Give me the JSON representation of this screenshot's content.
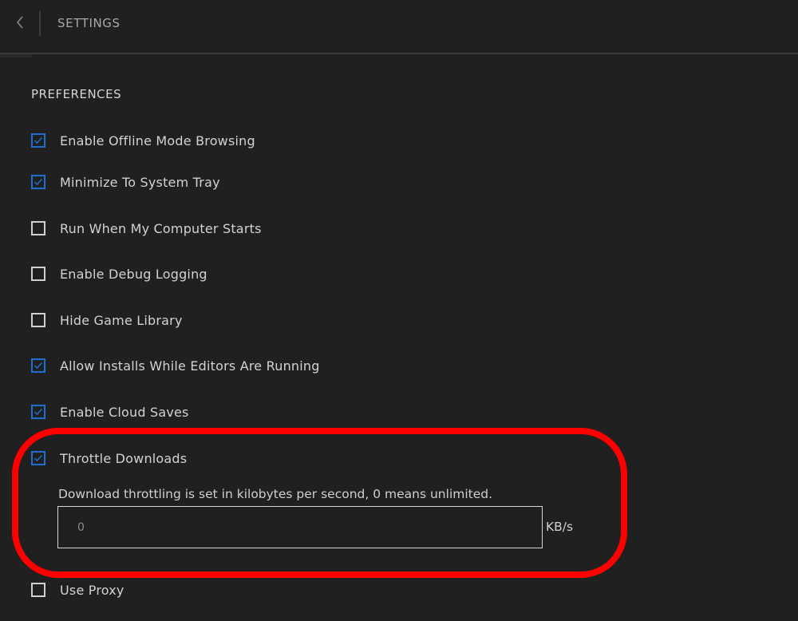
{
  "header": {
    "title": "SETTINGS",
    "back_icon": "chevron-left-icon"
  },
  "preferences": {
    "heading": "PREFERENCES",
    "options": [
      {
        "label": "Enable Offline Mode Browsing",
        "checked": true
      },
      {
        "label": "Minimize To System Tray",
        "checked": true
      },
      {
        "label": "Run When My Computer Starts",
        "checked": false
      },
      {
        "label": "Enable Debug Logging",
        "checked": false
      },
      {
        "label": "Hide Game Library",
        "checked": false
      },
      {
        "label": "Allow Installs While Editors Are Running",
        "checked": true
      },
      {
        "label": "Enable Cloud Saves",
        "checked": true
      },
      {
        "label": "Throttle Downloads",
        "checked": true
      },
      {
        "label": "Use Proxy",
        "checked": false
      }
    ]
  },
  "throttle": {
    "description": "Download throttling is set in kilobytes per second, 0 means unlimited.",
    "placeholder": "0",
    "value": "",
    "unit": "KB/s"
  },
  "colors": {
    "background": "#202020",
    "accent": "#1f6fd0",
    "highlight": "#ff0000"
  }
}
